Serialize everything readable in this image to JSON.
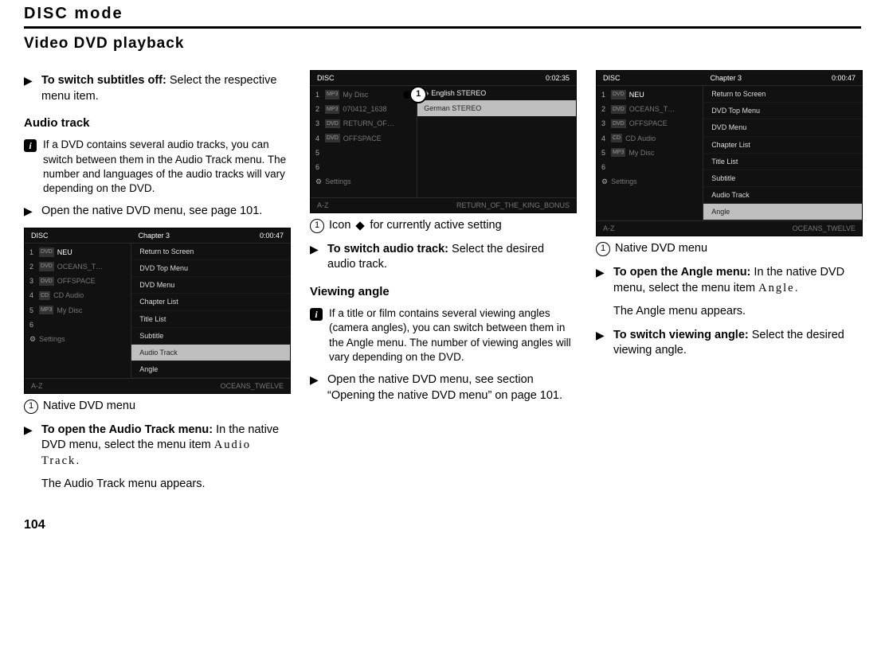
{
  "running_head": "DISC mode",
  "section_title": "Video DVD playback",
  "page_number": "104",
  "col1": {
    "step_subtitles": {
      "bold": "To switch subtitles off:",
      "rest": " Select the respective menu item."
    },
    "heading_audio": "Audio track",
    "info_audio": "If a DVD contains several audio tracks, you can switch between them in the Audio Track menu. The number and languages of the audio tracks will vary depending on the DVD.",
    "step_open_native": "Open the native DVD menu, see page 101.",
    "caption_native": "Native DVD menu",
    "step_open_audio_menu": {
      "bold": "To open the Audio Track menu:",
      "rest": " In the native DVD menu, select the menu item "
    },
    "menu_term_audio": "Audio Track",
    "after_menu_term": ".",
    "result_audio": "The Audio Track menu appears."
  },
  "col2": {
    "caption_icon": "Icon ",
    "caption_icon_after": " for currently active setting",
    "step_switch_audio": {
      "bold": "To switch audio track:",
      "rest": " Select the desired audio track."
    },
    "heading_angle": "Viewing angle",
    "info_angle": "If a title or film contains several viewing angles (camera angles), you can switch between them in the Angle menu. The number of viewing angles will vary depending on the DVD.",
    "step_open_native2": "Open the native DVD menu, see section “Opening the native DVD menu” on page 101."
  },
  "col3": {
    "caption_native": "Native DVD menu",
    "step_open_angle_menu": {
      "bold": "To open the Angle menu:",
      "rest": " In the native DVD menu, select the menu item "
    },
    "menu_term_angle": "Angle",
    "after_menu_term": ".",
    "result_angle": "The Angle menu appears.",
    "step_switch_angle": {
      "bold": "To switch viewing angle:",
      "rest": " Select the desired viewing angle."
    }
  },
  "circled_one": "1",
  "ss_common_top": {
    "left": "DISC",
    "mid": "",
    "right_ch": "Chapter 3",
    "right_time": "0:00:47"
  },
  "ss_common_top_audio": {
    "left": "DISC",
    "right_time": "0:02:35"
  },
  "ss_bottom_left": "A-Z",
  "ss_bottom_right_oceans": "OCEANS_TWELVE",
  "ss_bottom_right_king": "RETURN_OF_THE_KING_BONUS",
  "ss_left_list_ocean": [
    "NEU",
    "OCEANS_T…",
    "OFFSPACE",
    "CD Audio",
    "My Disc"
  ],
  "ss_left_list_audio": [
    "My Disc",
    "070412_1638",
    "RETURN_OF…",
    "OFFSPACE"
  ],
  "ss_settings_label": "Settings",
  "ss_native_menu": [
    "Return to Screen",
    "DVD Top Menu",
    "DVD Menu",
    "Chapter List",
    "Title List",
    "Subtitle",
    "Audio Track",
    "Angle"
  ],
  "ss_audio_current": "English STEREO",
  "ss_audio_result": "German STEREO"
}
